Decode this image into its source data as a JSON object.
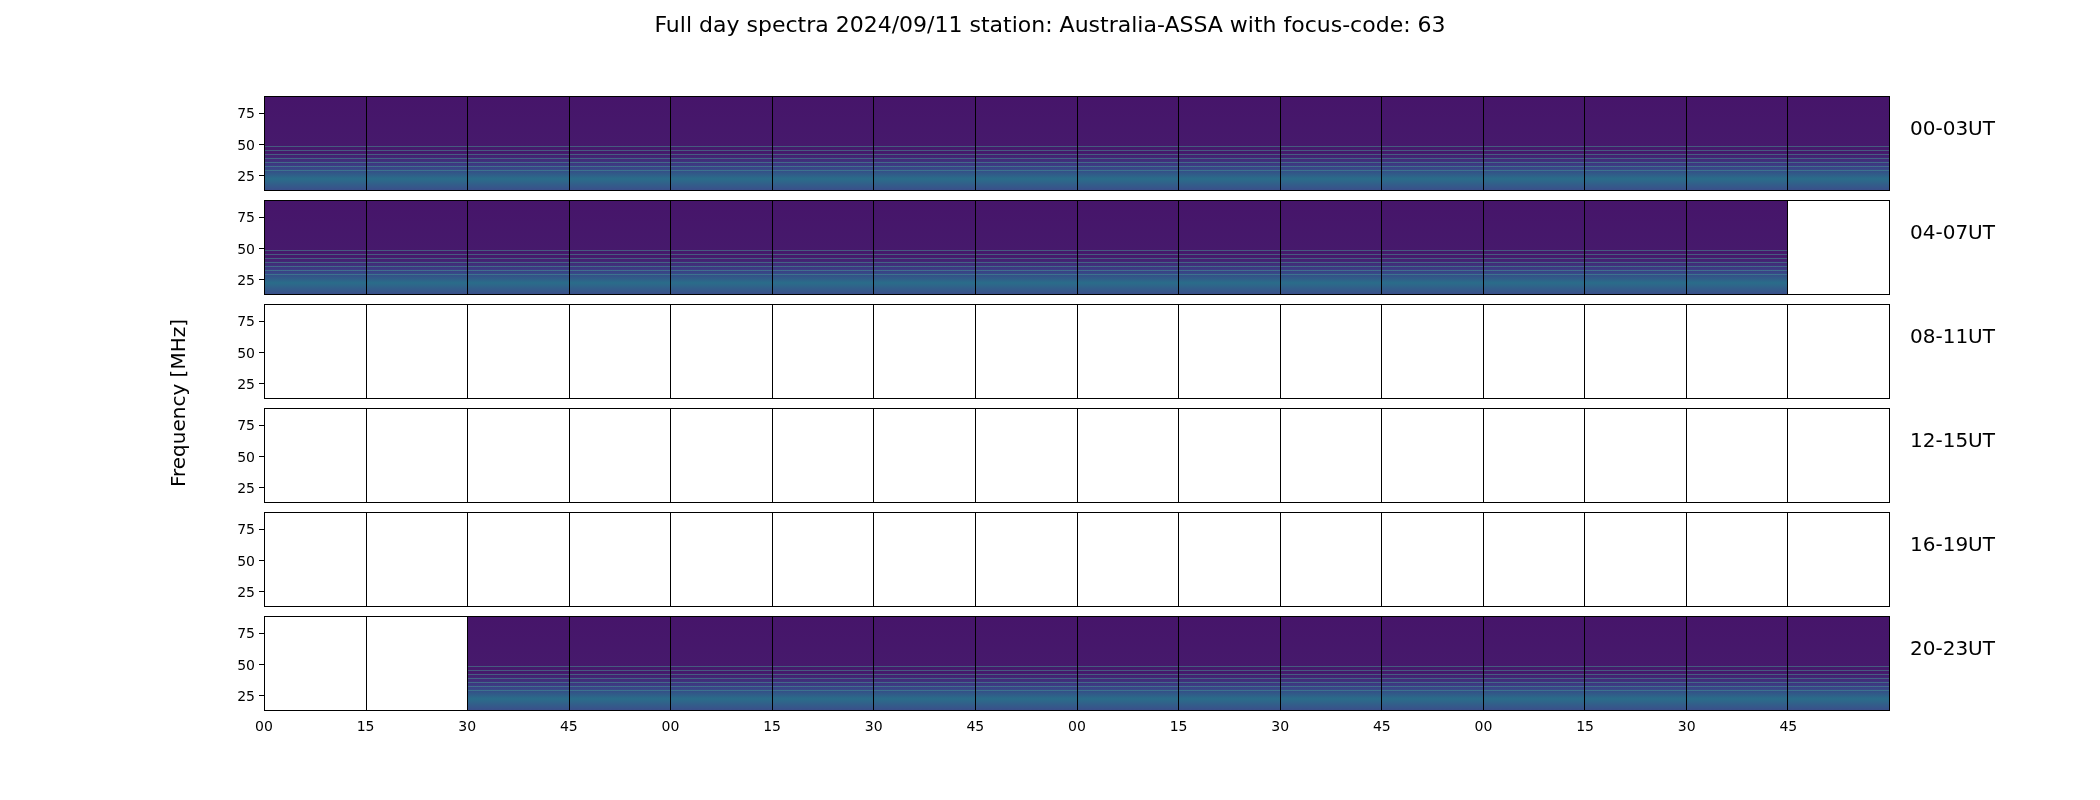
{
  "title": "Full day spectra 2024/09/11 station: Australia-ASSA with focus-code: 63",
  "ylabel": "Frequency [MHz]",
  "rows": [
    {
      "label": "00-03UT",
      "yticks": [
        "75",
        "50",
        "25"
      ],
      "panels": [
        {
          "has_data": true
        },
        {
          "has_data": true
        },
        {
          "has_data": true
        },
        {
          "has_data": true
        },
        {
          "has_data": true
        },
        {
          "has_data": true
        },
        {
          "has_data": true
        },
        {
          "has_data": true
        },
        {
          "has_data": true
        },
        {
          "has_data": true
        },
        {
          "has_data": true
        },
        {
          "has_data": true
        },
        {
          "has_data": true
        },
        {
          "has_data": true
        },
        {
          "has_data": true
        },
        {
          "has_data": true
        }
      ]
    },
    {
      "label": "04-07UT",
      "yticks": [
        "75",
        "50",
        "25"
      ],
      "panels": [
        {
          "has_data": true
        },
        {
          "has_data": true
        },
        {
          "has_data": true
        },
        {
          "has_data": true
        },
        {
          "has_data": true
        },
        {
          "has_data": true
        },
        {
          "has_data": true
        },
        {
          "has_data": true
        },
        {
          "has_data": true
        },
        {
          "has_data": true
        },
        {
          "has_data": true
        },
        {
          "has_data": true
        },
        {
          "has_data": true
        },
        {
          "has_data": true
        },
        {
          "has_data": true
        },
        {
          "has_data": false
        }
      ]
    },
    {
      "label": "08-11UT",
      "yticks": [
        "75",
        "50",
        "25"
      ],
      "panels": [
        {
          "has_data": false
        },
        {
          "has_data": false
        },
        {
          "has_data": false
        },
        {
          "has_data": false
        },
        {
          "has_data": false
        },
        {
          "has_data": false
        },
        {
          "has_data": false
        },
        {
          "has_data": false
        },
        {
          "has_data": false
        },
        {
          "has_data": false
        },
        {
          "has_data": false
        },
        {
          "has_data": false
        },
        {
          "has_data": false
        },
        {
          "has_data": false
        },
        {
          "has_data": false
        },
        {
          "has_data": false
        }
      ]
    },
    {
      "label": "12-15UT",
      "yticks": [
        "75",
        "50",
        "25"
      ],
      "panels": [
        {
          "has_data": false
        },
        {
          "has_data": false
        },
        {
          "has_data": false
        },
        {
          "has_data": false
        },
        {
          "has_data": false
        },
        {
          "has_data": false
        },
        {
          "has_data": false
        },
        {
          "has_data": false
        },
        {
          "has_data": false
        },
        {
          "has_data": false
        },
        {
          "has_data": false
        },
        {
          "has_data": false
        },
        {
          "has_data": false
        },
        {
          "has_data": false
        },
        {
          "has_data": false
        },
        {
          "has_data": false
        }
      ]
    },
    {
      "label": "16-19UT",
      "yticks": [
        "75",
        "50",
        "25"
      ],
      "panels": [
        {
          "has_data": false
        },
        {
          "has_data": false
        },
        {
          "has_data": false
        },
        {
          "has_data": false
        },
        {
          "has_data": false
        },
        {
          "has_data": false
        },
        {
          "has_data": false
        },
        {
          "has_data": false
        },
        {
          "has_data": false
        },
        {
          "has_data": false
        },
        {
          "has_data": false
        },
        {
          "has_data": false
        },
        {
          "has_data": false
        },
        {
          "has_data": false
        },
        {
          "has_data": false
        },
        {
          "has_data": false
        }
      ]
    },
    {
      "label": "20-23UT",
      "yticks": [
        "75",
        "50",
        "25"
      ],
      "panels": [
        {
          "has_data": false
        },
        {
          "has_data": false
        },
        {
          "has_data": true
        },
        {
          "has_data": true
        },
        {
          "has_data": true
        },
        {
          "has_data": true
        },
        {
          "has_data": true
        },
        {
          "has_data": true
        },
        {
          "has_data": true
        },
        {
          "has_data": true
        },
        {
          "has_data": true
        },
        {
          "has_data": true
        },
        {
          "has_data": true
        },
        {
          "has_data": true
        },
        {
          "has_data": true
        },
        {
          "has_data": true
        }
      ]
    }
  ],
  "xticks": [
    "00",
    "15",
    "30",
    "45",
    "00",
    "15",
    "30",
    "45",
    "00",
    "15",
    "30",
    "45",
    "00",
    "15",
    "30",
    "45"
  ]
}
